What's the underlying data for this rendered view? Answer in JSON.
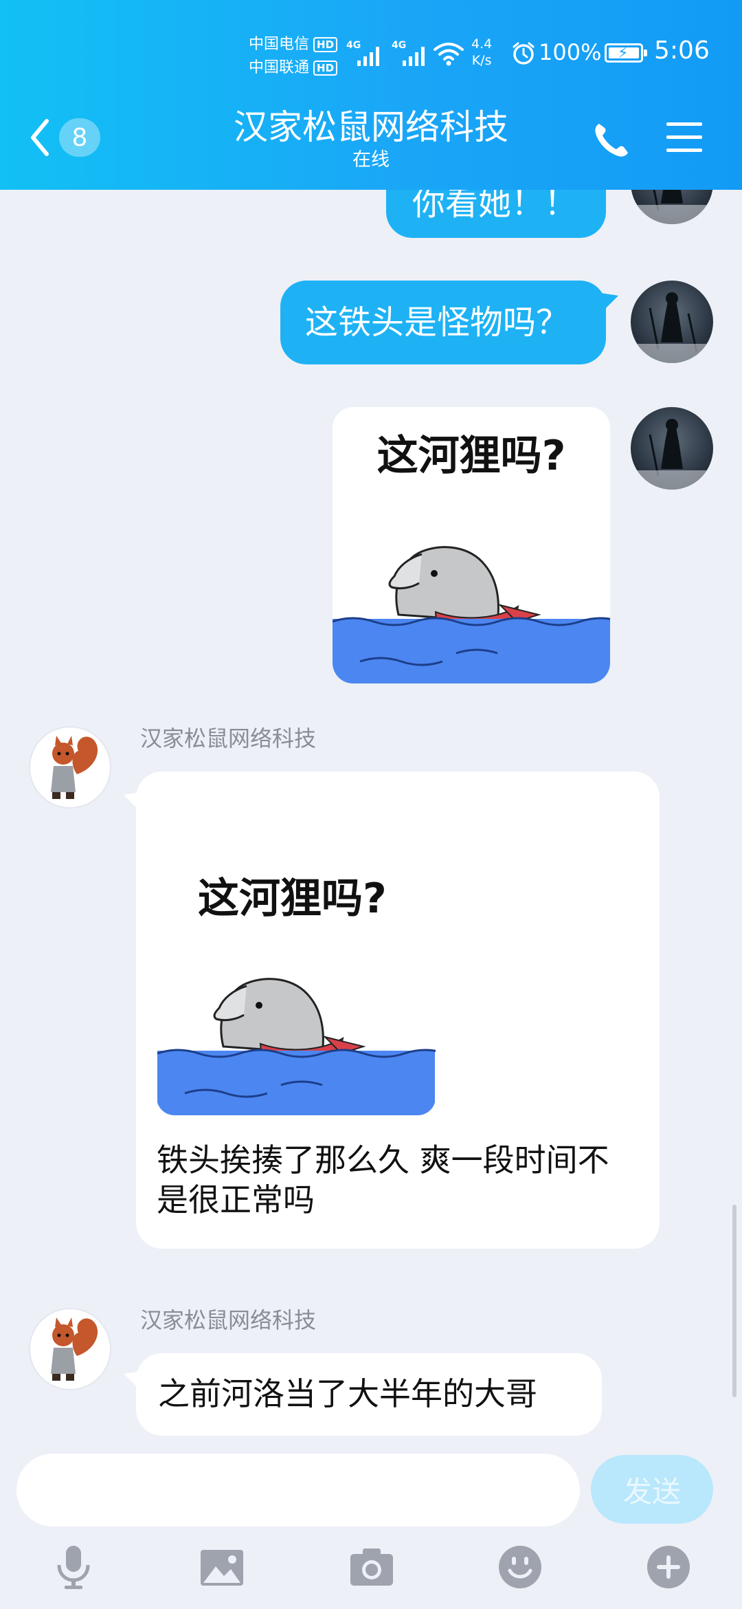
{
  "status_bar": {
    "carrier_1": "中国电信",
    "carrier_2": "中国联通",
    "hd_label": "HD",
    "network_1": "4G",
    "network_2": "4G",
    "speed_value": "4.4",
    "speed_unit": "K/s",
    "battery": "100%",
    "time": "5:06"
  },
  "header": {
    "back_badge": "8",
    "title": "汉家松鼠网络科技",
    "subtitle": "在线"
  },
  "messages": {
    "m1_text": "你看她！！",
    "m2_text": "这铁头是怪物吗？",
    "m3_sticker_caption": "这河狸吗?",
    "m4_sender": "汉家松鼠网络科技",
    "m4_sticker_caption": "这河狸吗?",
    "m4_text": " 铁头挨揍了那么久 爽一段时间不是很正常吗",
    "m5_sender": "汉家松鼠网络科技",
    "m5_text": "之前河洛当了大半年的大哥"
  },
  "input": {
    "placeholder": "",
    "send_label": "发送"
  },
  "colors": {
    "header_gradient_start": "#12c0f5",
    "header_gradient_end": "#129bf5",
    "bubble_blue": "#1eb2f5",
    "chat_bg": "#edf0f7",
    "send_disabled": "#b9e7fc"
  },
  "icons": [
    "back-chevron-icon",
    "phone-icon",
    "menu-icon",
    "microphone-icon",
    "image-icon",
    "camera-icon",
    "emoji-icon",
    "plus-icon"
  ]
}
